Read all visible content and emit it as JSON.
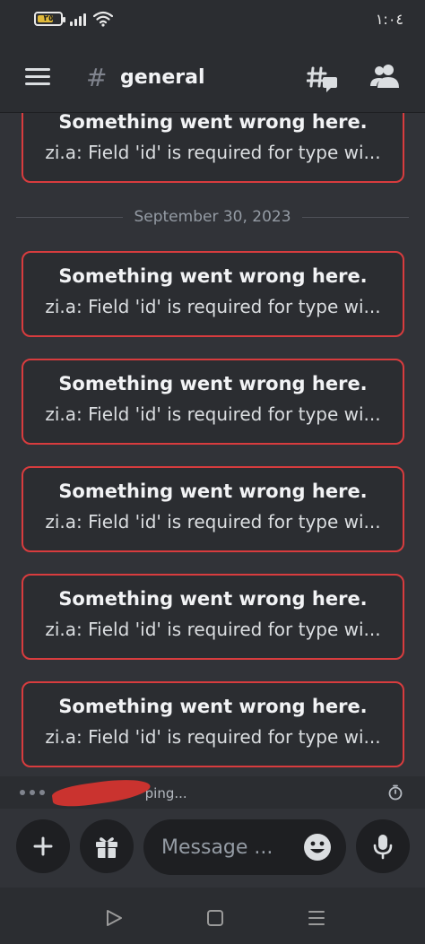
{
  "status_bar": {
    "battery_level": "٢٥",
    "time": "١:٠٤"
  },
  "header": {
    "channel_name": "general",
    "icons": [
      "menu-icon",
      "hash-icon",
      "threads-icon",
      "members-icon"
    ]
  },
  "messages": {
    "date_divider": "September 30, 2023",
    "errors": [
      {
        "title": "Something went wrong here.",
        "detail": "zi.a: Field 'id' is required for type wi..."
      },
      {
        "title": "Something went wrong here.",
        "detail": "zi.a: Field 'id' is required for type wi..."
      },
      {
        "title": "Something went wrong here.",
        "detail": "zi.a: Field 'id' is required for type wi..."
      },
      {
        "title": "Something went wrong here.",
        "detail": "zi.a: Field 'id' is required for type wi..."
      },
      {
        "title": "Something went wrong here.",
        "detail": "zi.a: Field 'id' is required for type wi..."
      },
      {
        "title": "Something went wrong here.",
        "detail": "zi.a: Field 'id' is required for type wi..."
      }
    ]
  },
  "typing": {
    "text": "ping..."
  },
  "composer": {
    "placeholder": "Message ..."
  },
  "colors": {
    "background": "#313338",
    "bar": "#2b2d31",
    "error_border": "#d83c3e",
    "input_bg": "#1e1f22"
  }
}
